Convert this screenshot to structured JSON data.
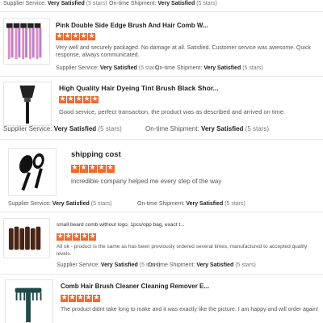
{
  "reviews": [
    {
      "supplier_label": "Supplier Service:",
      "supplier_value": "Very Satisfied",
      "supplier_note": "(5 stars)",
      "shipment_label": "On-time Shipment:",
      "shipment_value": "Very Satisfied",
      "shipment_note": "(5 stars)"
    },
    {
      "title": "Pink Double Side Edge Brush And Hair Comb W...",
      "rating": 5,
      "comment": "Very well and securely packaged. No damage at all. Satisfied. Customer service was awesome. Quick response, always communicated.",
      "supplier_label": "Supplier Service:",
      "supplier_value": "Very Satisfied",
      "supplier_note": "(5 stars)",
      "shipment_label": "On-time Shipment:",
      "shipment_value": "Very Satisfied",
      "shipment_note": "(5 stars)"
    },
    {
      "title": "High Quality Hair Dyeing Tint Brush Black Shor...",
      "rating": 5,
      "comment": "Good service, perfect transaction, the product was as described and arrived on time.",
      "supplier_label": "Supplier Service:",
      "supplier_value": "Very Satisfied",
      "supplier_note": "(5 stars)",
      "shipment_label": "On-time Shipment:",
      "shipment_value": "Very Satisfied",
      "shipment_note": "(5 stars)"
    },
    {
      "title": "shipping cost",
      "rating": 5,
      "comment": "incredible company helped me every step of the way",
      "supplier_label": "Supplier Service:",
      "supplier_value": "Very Satisfied",
      "supplier_note": "(5 stars)",
      "shipment_label": "On-time Shipment:",
      "shipment_value": "Very Satisfied",
      "shipment_note": "(5 stars)"
    },
    {
      "title": "small beard comb without logo, 1pcs/opp bag, exact t...",
      "rating": 5,
      "comment": "All ok - product is the same as has been previously ordered several times, manufactured to accepted quality levels.",
      "supplier_label": "Supplier Service:",
      "supplier_value": "Very Satisfied",
      "supplier_note": "(5 stars)",
      "shipment_label": "On-time Shipment:",
      "shipment_value": "Very Satisfied",
      "shipment_note": "(5 stars)"
    },
    {
      "title": "Comb Hair Brush Cleaner Cleaning Remover E...",
      "rating": 5,
      "comment": "The product didnt take long to make and it was exactly like the picture. I am happy and will order again!"
    }
  ],
  "colors": {
    "star": "#f5692a",
    "divider": "#e8e8e8"
  },
  "icons": {
    "review_1": "pink-comb-set-image",
    "review_2": "tint-brush-image",
    "review_3": "oval-paddle-brush-image",
    "review_4": "beard-comb-set-image",
    "review_5": "brush-cleaner-image",
    "star": "star-icon"
  }
}
